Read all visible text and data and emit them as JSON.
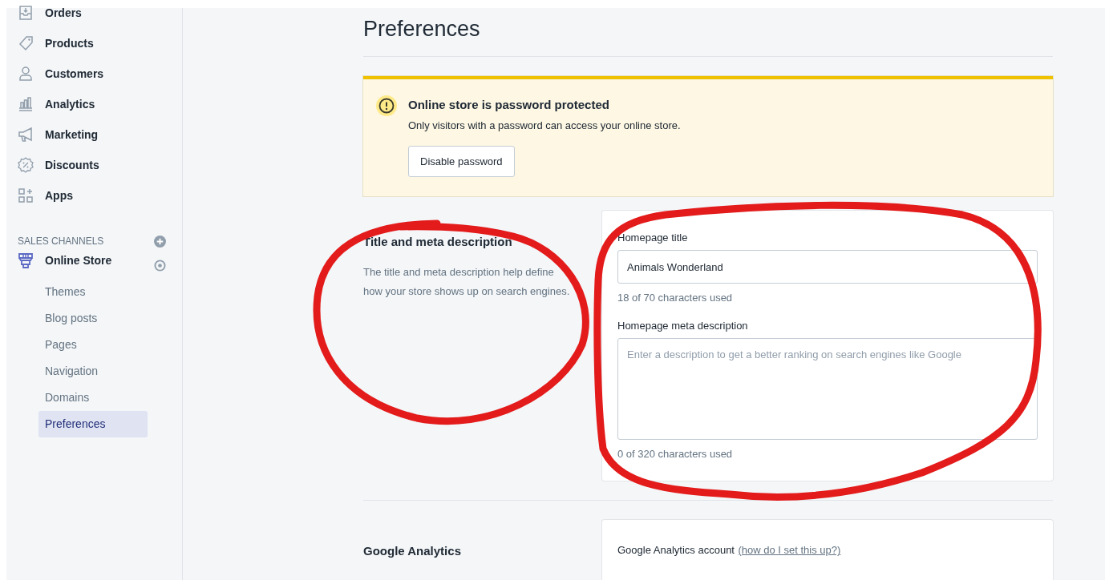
{
  "sidebar": {
    "items": [
      {
        "label": "Orders"
      },
      {
        "label": "Products"
      },
      {
        "label": "Customers"
      },
      {
        "label": "Analytics"
      },
      {
        "label": "Marketing"
      },
      {
        "label": "Discounts"
      },
      {
        "label": "Apps"
      }
    ],
    "sales_channels": {
      "heading": "SALES CHANNELS",
      "channel": "Online Store",
      "subitems": [
        {
          "label": "Themes",
          "selected": false
        },
        {
          "label": "Blog posts",
          "selected": false
        },
        {
          "label": "Pages",
          "selected": false
        },
        {
          "label": "Navigation",
          "selected": false
        },
        {
          "label": "Domains",
          "selected": false
        },
        {
          "label": "Preferences",
          "selected": true
        }
      ]
    }
  },
  "page_title": "Preferences",
  "banner": {
    "title": "Online store is password protected",
    "text": "Only visitors with a password can access your online store.",
    "button": "Disable password"
  },
  "sections": [
    {
      "title": "Title and meta description",
      "description": "The title and meta description help define how your store shows up on search engines.",
      "fields": [
        {
          "kind": "input",
          "label": "Homepage title",
          "value": "Animals Wonderland",
          "help": "18 of 70 characters used"
        },
        {
          "kind": "textarea",
          "label": "Homepage meta description",
          "placeholder": "Enter a description to get a better ranking on search engines like Google",
          "help": "0 of 320 characters used"
        }
      ]
    },
    {
      "title": "Google Analytics",
      "account_label": "Google Analytics account",
      "link": "(how do I set this up?)"
    }
  ]
}
